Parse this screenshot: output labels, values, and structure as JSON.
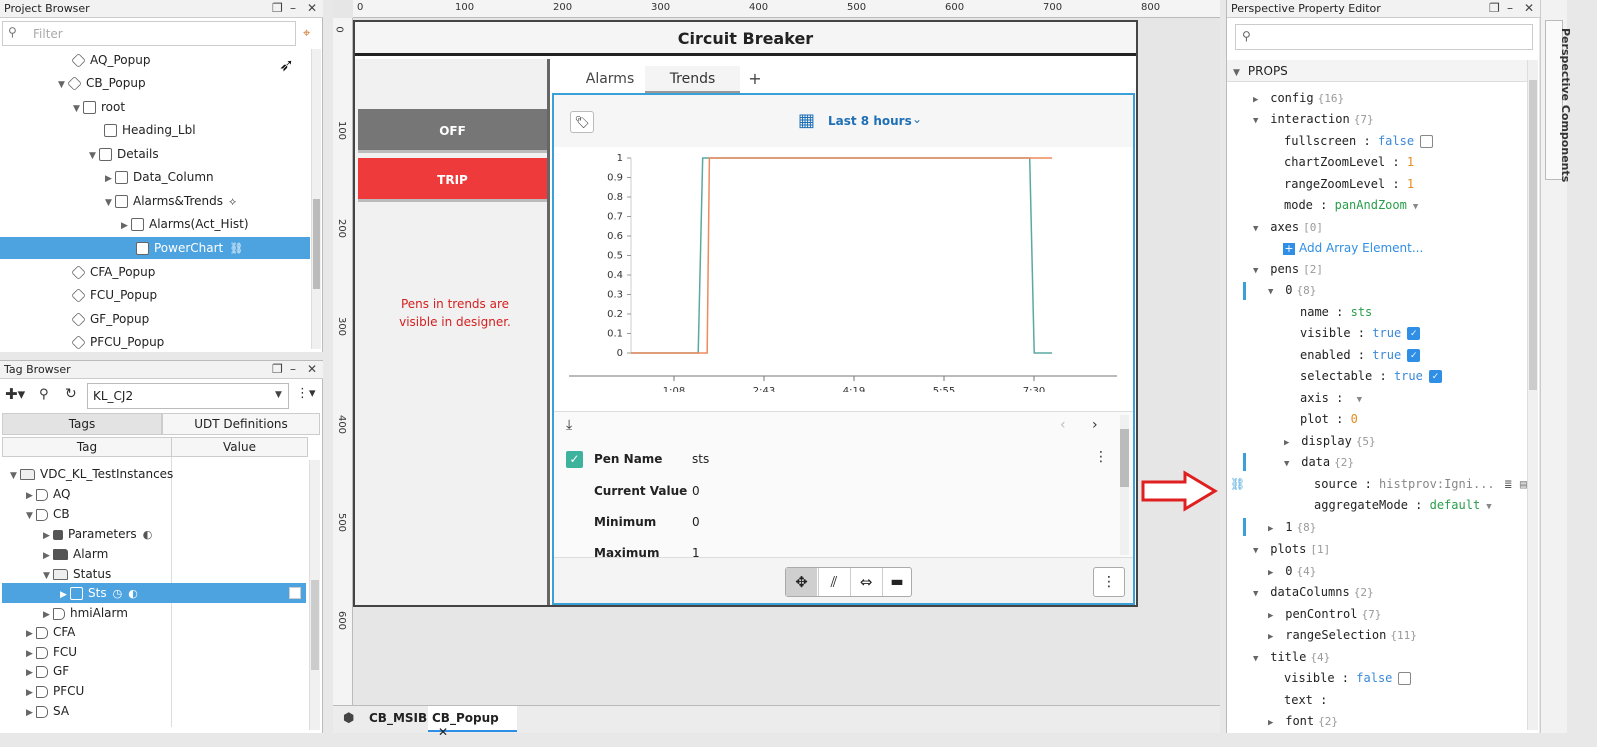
{
  "project_browser": {
    "title": "Project Browser",
    "filter_placeholder": "Filter",
    "items": [
      {
        "label": "AQ_Popup"
      },
      {
        "label": "CB_Popup"
      },
      {
        "label": "root"
      },
      {
        "label": "Heading_Lbl"
      },
      {
        "label": "Details"
      },
      {
        "label": "Data_Column"
      },
      {
        "label": "Alarms&Trends"
      },
      {
        "label": "Alarms(Act_Hist)"
      },
      {
        "label": "PowerChart"
      },
      {
        "label": "CFA_Popup"
      },
      {
        "label": "FCU_Popup"
      },
      {
        "label": "GF_Popup"
      },
      {
        "label": "PFCU_Popup"
      }
    ]
  },
  "tag_browser": {
    "title": "Tag Browser",
    "provider": "KL_CJ2",
    "tabs": [
      "Tags",
      "UDT Definitions"
    ],
    "columns": [
      "Tag",
      "Value"
    ],
    "items": [
      {
        "label": "VDC_KL_TestInstances"
      },
      {
        "label": "AQ"
      },
      {
        "label": "CB"
      },
      {
        "label": "Parameters"
      },
      {
        "label": "Alarm"
      },
      {
        "label": "Status"
      },
      {
        "label": "Sts"
      },
      {
        "label": "hmiAlarm"
      },
      {
        "label": "CFA"
      },
      {
        "label": "FCU"
      },
      {
        "label": "GF"
      },
      {
        "label": "PFCU"
      },
      {
        "label": "SA"
      }
    ]
  },
  "canvas": {
    "ruler_top": [
      "0",
      "100",
      "200",
      "300",
      "400",
      "500",
      "600",
      "700",
      "800"
    ],
    "ruler_left": [
      "0",
      "100",
      "200",
      "300",
      "400",
      "500",
      "600"
    ],
    "view_title": "Circuit Breaker",
    "off_label": "OFF",
    "trip_label": "TRIP",
    "note": "Pens in trends are visible in designer.",
    "tabs": [
      "Alarms",
      "Trends",
      "+"
    ],
    "range_label": "Last 8 hours",
    "table": [
      {
        "label": "Pen Name",
        "value": "sts"
      },
      {
        "label": "Current Value",
        "value": "0"
      },
      {
        "label": "Minimum",
        "value": "0"
      },
      {
        "label": "Maximum",
        "value": "1"
      }
    ],
    "doc_tabs": [
      "CB_MSIB",
      "CB_Popup"
    ]
  },
  "chart_data": {
    "type": "line",
    "y_ticks": [
      "1",
      "0.9",
      "0.8",
      "0.7",
      "0.6",
      "0.5",
      "0.4",
      "0.3",
      "0.2",
      "0.1",
      "0"
    ],
    "x_ticks": [
      "1:08",
      "2:43",
      "4:19",
      "5:55",
      "7:30"
    ],
    "ylim": [
      0,
      1
    ],
    "series": [
      {
        "color": "#5aa9a0",
        "x": [
          0,
          0.15,
          0.16,
          0.89,
          0.9,
          0.94
        ],
        "y": [
          0,
          0,
          1,
          1,
          0,
          0
        ]
      },
      {
        "color": "#f08a5d",
        "x": [
          0,
          0.17,
          0.175,
          0.94
        ],
        "y": [
          0,
          0,
          1,
          1
        ]
      }
    ]
  },
  "property_editor": {
    "title": "Perspective Property Editor",
    "side_tab": "Perspective Components",
    "section": "PROPS",
    "rows": [
      {
        "key": "config",
        "count": "{16}"
      },
      {
        "key": "interaction",
        "count": "{7}"
      },
      {
        "key": "fullscreen",
        "value": "false"
      },
      {
        "key": "chartZoomLevel",
        "value": "1"
      },
      {
        "key": "rangeZoomLevel",
        "value": "1"
      },
      {
        "key": "mode",
        "value": "panAndZoom"
      },
      {
        "key": "axes",
        "count": "[0]"
      },
      {
        "key": "Add Array Element..."
      },
      {
        "key": "pens",
        "count": "[2]"
      },
      {
        "key": "0",
        "count": "{8}"
      },
      {
        "key": "name",
        "value": "sts"
      },
      {
        "key": "visible",
        "value": "true"
      },
      {
        "key": "enabled",
        "value": "true"
      },
      {
        "key": "selectable",
        "value": "true"
      },
      {
        "key": "axis",
        "value": ""
      },
      {
        "key": "plot",
        "value": "0"
      },
      {
        "key": "display",
        "count": "{5}"
      },
      {
        "key": "data",
        "count": "{2}"
      },
      {
        "key": "source",
        "value": "histprov:Igni..."
      },
      {
        "key": "aggregateMode",
        "value": "default"
      },
      {
        "key": "1",
        "count": "{8}"
      },
      {
        "key": "plots",
        "count": "[1]"
      },
      {
        "key": "0",
        "count": "{4}"
      },
      {
        "key": "dataColumns",
        "count": "{2}"
      },
      {
        "key": "penControl",
        "count": "{7}"
      },
      {
        "key": "rangeSelection",
        "count": "{11}"
      },
      {
        "key": "title",
        "count": "{4}"
      },
      {
        "key": "visible",
        "value": "false"
      },
      {
        "key": "text",
        "value": ""
      },
      {
        "key": "font",
        "count": "{2}"
      }
    ]
  }
}
